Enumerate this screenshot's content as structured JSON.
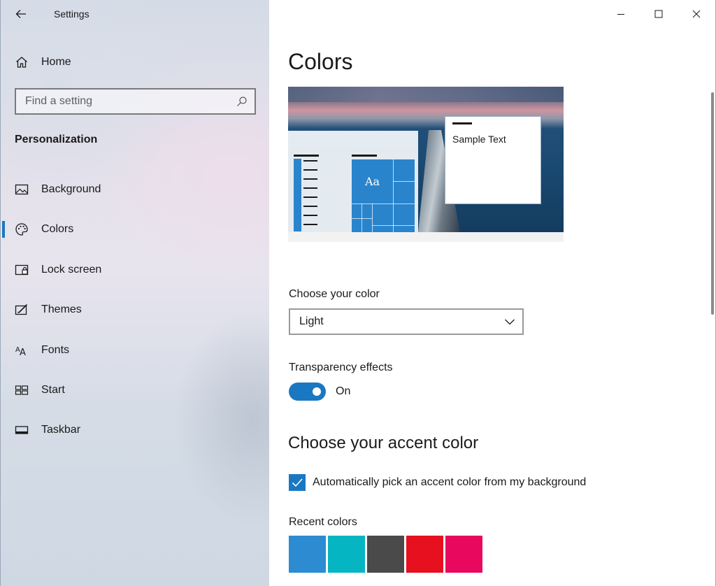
{
  "window": {
    "app_title": "Settings",
    "controls": [
      "minimize-icon",
      "maximize-icon",
      "close-icon"
    ]
  },
  "sidebar": {
    "home_label": "Home",
    "search": {
      "placeholder": "Find a setting",
      "value": ""
    },
    "section_title": "Personalization",
    "items": [
      {
        "label": "Background",
        "icon": "picture-icon",
        "selected": false
      },
      {
        "label": "Colors",
        "icon": "palette-icon",
        "selected": true
      },
      {
        "label": "Lock screen",
        "icon": "lock-screen-icon",
        "selected": false
      },
      {
        "label": "Themes",
        "icon": "themes-icon",
        "selected": false
      },
      {
        "label": "Fonts",
        "icon": "fonts-icon",
        "selected": false
      },
      {
        "label": "Start",
        "icon": "start-icon",
        "selected": false
      },
      {
        "label": "Taskbar",
        "icon": "taskbar-icon",
        "selected": false
      }
    ]
  },
  "main": {
    "page_title": "Colors",
    "preview": {
      "tile_text": "Aa",
      "sample_text": "Sample Text"
    },
    "choose_color": {
      "label": "Choose your color",
      "selected": "Light"
    },
    "transparency": {
      "label": "Transparency effects",
      "state": "On",
      "enabled": true
    },
    "accent": {
      "heading": "Choose your accent color",
      "auto_pick_label": "Automatically pick an accent color from my background",
      "auto_pick_checked": true,
      "recent_label": "Recent colors",
      "recent_colors": [
        "#2d8bd1",
        "#05b6c2",
        "#4a4a4a",
        "#e6101f",
        "#e8095f"
      ]
    }
  },
  "colors": {
    "accent": "#1a78c2"
  }
}
